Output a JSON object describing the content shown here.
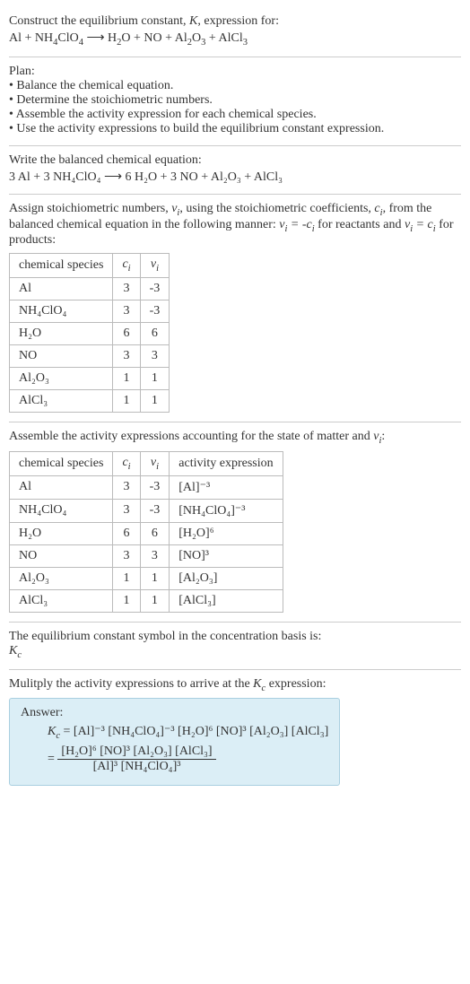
{
  "intro": {
    "line1_a": "Construct the equilibrium constant, ",
    "line1_b": ", expression for:",
    "eq_lhs": "Al + NH",
    "eq_lhs_s1": "4",
    "eq_lhs2": "ClO",
    "eq_lhs_s2": "4",
    "arrow": " ⟶ ",
    "eq_rhs": "H",
    "eq_rhs_s1": "2",
    "eq_rhs2": "O + NO + Al",
    "eq_rhs_s2": "2",
    "eq_rhs3": "O",
    "eq_rhs_s3": "3",
    "eq_rhs4": " + AlCl",
    "eq_rhs_s4": "3"
  },
  "plan": {
    "title": "Plan:",
    "b1": "• Balance the chemical equation.",
    "b2": "• Determine the stoichiometric numbers.",
    "b3": "• Assemble the activity expression for each chemical species.",
    "b4": "• Use the activity expressions to build the equilibrium constant expression."
  },
  "balanced": {
    "title": "Write the balanced chemical equation:",
    "eq": "3 Al + 3 NH₄ClO₄ ⟶ 6 H₂O + 3 NO + Al₂O₃ + AlCl₃"
  },
  "stoich": {
    "intro_a": "Assign stoichiometric numbers, ",
    "intro_b": ", using the stoichiometric coefficients, ",
    "intro_c": ", from the balanced chemical equation in the following manner: ",
    "intro_d": " for reactants and ",
    "intro_e": " for products:",
    "h1": "chemical species",
    "rows": [
      {
        "sp": "Al",
        "c": "3",
        "v": "-3"
      },
      {
        "sp": "NH₄ClO₄",
        "c": "3",
        "v": "-3"
      },
      {
        "sp": "H₂O",
        "c": "6",
        "v": "6"
      },
      {
        "sp": "NO",
        "c": "3",
        "v": "3"
      },
      {
        "sp": "Al₂O₃",
        "c": "1",
        "v": "1"
      },
      {
        "sp": "AlCl₃",
        "c": "1",
        "v": "1"
      }
    ]
  },
  "activity": {
    "title_a": "Assemble the activity expressions accounting for the state of matter and ",
    "title_b": ":",
    "h1": "chemical species",
    "h4": "activity expression",
    "rows": [
      {
        "sp": "Al",
        "c": "3",
        "v": "-3",
        "ae": "[Al]⁻³"
      },
      {
        "sp": "NH₄ClO₄",
        "c": "3",
        "v": "-3",
        "ae": "[NH₄ClO₄]⁻³"
      },
      {
        "sp": "H₂O",
        "c": "6",
        "v": "6",
        "ae": "[H₂O]⁶"
      },
      {
        "sp": "NO",
        "c": "3",
        "v": "3",
        "ae": "[NO]³"
      },
      {
        "sp": "Al₂O₃",
        "c": "1",
        "v": "1",
        "ae": "[Al₂O₃]"
      },
      {
        "sp": "AlCl₃",
        "c": "1",
        "v": "1",
        "ae": "[AlCl₃]"
      }
    ]
  },
  "symbol_section": {
    "line": "The equilibrium constant symbol in the concentration basis is:"
  },
  "final": {
    "line_a": "Mulitply the activity expressions to arrive at the ",
    "line_b": " expression:",
    "answer_label": "Answer:",
    "flat": " = [Al]⁻³ [NH₄ClO₄]⁻³ [H₂O]⁶ [NO]³ [Al₂O₃] [AlCl₃]",
    "eq_sign": "= ",
    "num": "[H₂O]⁶ [NO]³ [Al₂O₃] [AlCl₃]",
    "den": "[Al]³ [NH₄ClO₄]³"
  }
}
